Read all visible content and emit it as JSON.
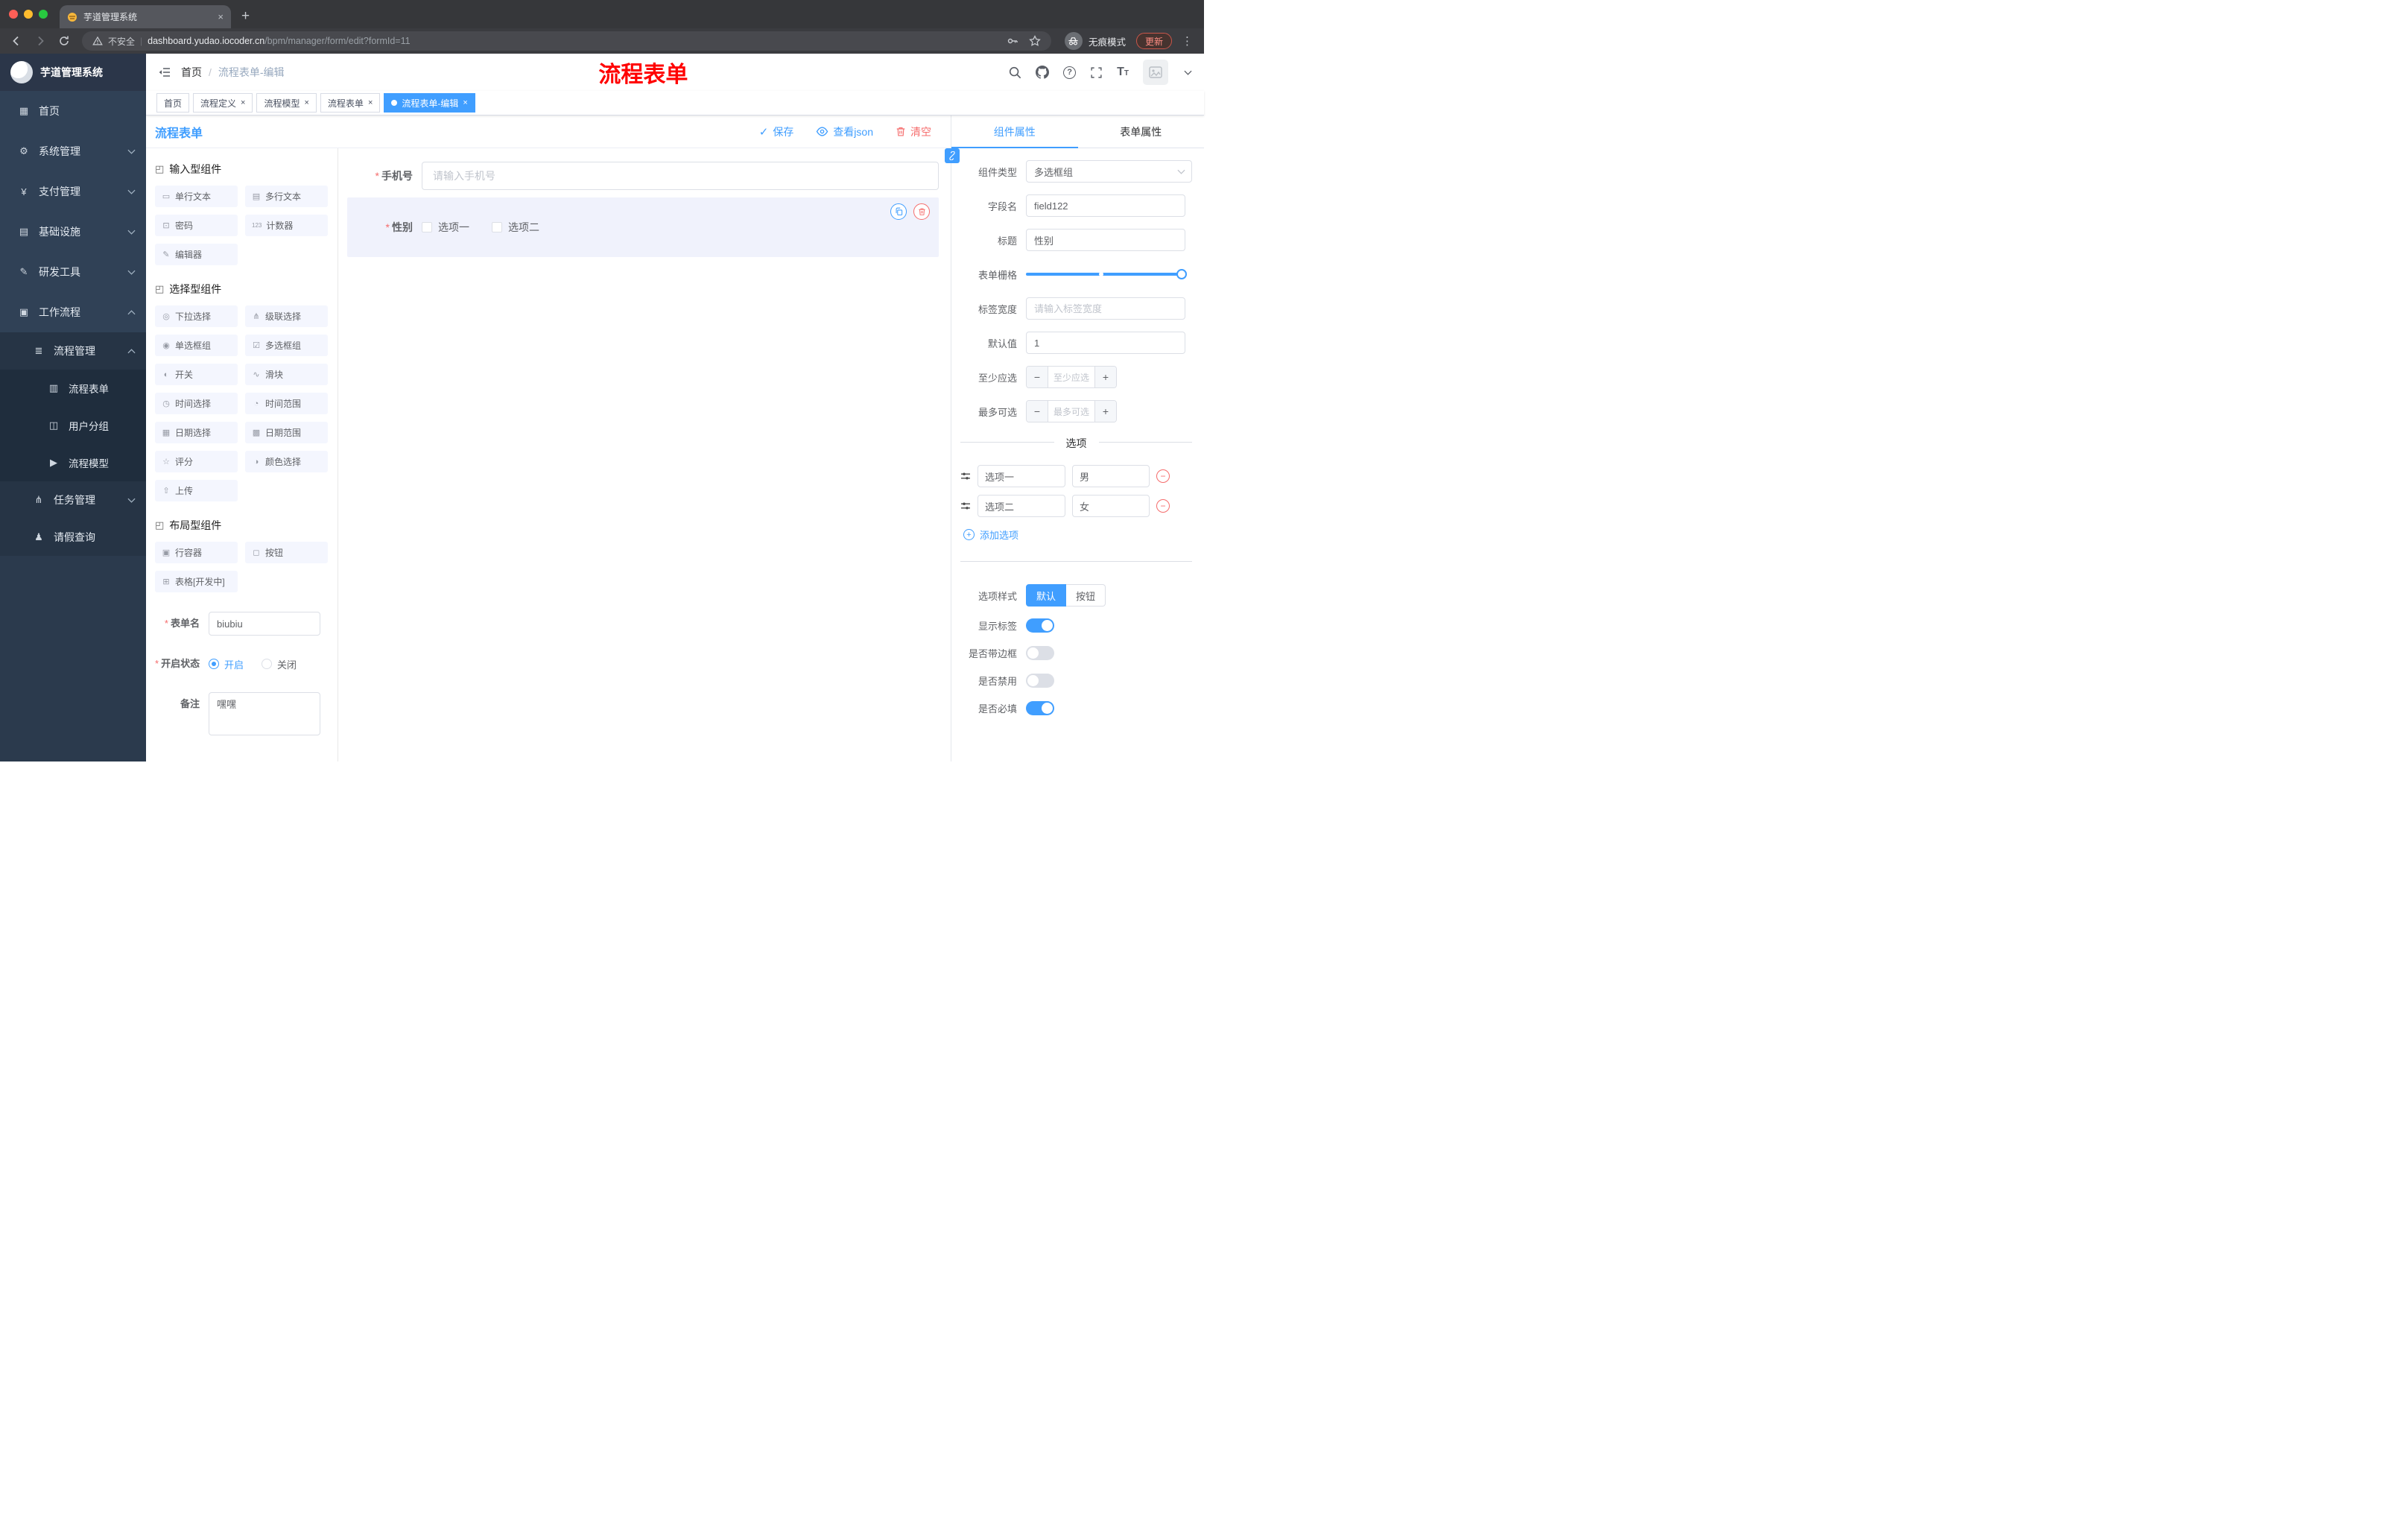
{
  "ui": {
    "close": "×",
    "plus": "+",
    "minus": "−",
    "dots": "⋮",
    "asterisk": "*",
    "pipe": "|",
    "qmark": "?",
    "t": "T",
    "check": "✓"
  },
  "chrome": {
    "tab_title": "芋道管理系统",
    "security_label": "不安全",
    "url_host": "dashboard.yudao.iocoder.cn",
    "url_path": "/bpm/manager/form/edit?formId=11",
    "incognito_label": "无痕模式",
    "update_label": "更新"
  },
  "sidebar": {
    "app_title": "芋道管理系统",
    "items": [
      {
        "label": "首页",
        "icon": "▦"
      },
      {
        "label": "系统管理",
        "icon": "⚙"
      },
      {
        "label": "支付管理",
        "icon": "¥"
      },
      {
        "label": "基础设施",
        "icon": "▤"
      },
      {
        "label": "研发工具",
        "icon": "✎"
      },
      {
        "label": "工作流程",
        "icon": "▣"
      },
      {
        "label": "流程管理",
        "icon": "≣"
      },
      {
        "label": "流程表单",
        "icon": "▥"
      },
      {
        "label": "用户分组",
        "icon": "◫"
      },
      {
        "label": "流程模型",
        "icon": "▶"
      },
      {
        "label": "任务管理",
        "icon": "⋔"
      },
      {
        "label": "请假查询",
        "icon": "♟"
      }
    ]
  },
  "header": {
    "breadcrumb_home": "首页",
    "breadcrumb_sep": "/",
    "breadcrumb_current": "流程表单-编辑",
    "annotation": "流程表单"
  },
  "tags": [
    {
      "label": "首页",
      "closable": false,
      "active": false
    },
    {
      "label": "流程定义",
      "closable": true,
      "active": false
    },
    {
      "label": "流程模型",
      "closable": true,
      "active": false
    },
    {
      "label": "流程表单",
      "closable": true,
      "active": false
    },
    {
      "label": "流程表单-编辑",
      "closable": true,
      "active": true
    }
  ],
  "designer": {
    "title": "流程表单",
    "save_label": "保存",
    "view_json_label": "查看json",
    "clear_label": "清空",
    "group_input": {
      "title": "输入型组件",
      "icon": "◰"
    },
    "group_select": {
      "title": "选择型组件",
      "icon": "◰"
    },
    "group_layout": {
      "title": "布局型组件",
      "icon": "◰"
    },
    "input_items": [
      {
        "label": "单行文本",
        "icon": "▭"
      },
      {
        "label": "多行文本",
        "icon": "▤"
      },
      {
        "label": "密码",
        "icon": "⊡"
      },
      {
        "label": "计数器",
        "icon": "123"
      },
      {
        "label": "编辑器",
        "icon": "✎"
      }
    ],
    "select_items": [
      {
        "label": "下拉选择",
        "icon": "◎"
      },
      {
        "label": "级联选择",
        "icon": "⋔"
      },
      {
        "label": "单选框组",
        "icon": "◉"
      },
      {
        "label": "多选框组",
        "icon": "☑"
      },
      {
        "label": "开关",
        "icon": "◐"
      },
      {
        "label": "滑块",
        "icon": "∿"
      },
      {
        "label": "时间选择",
        "icon": "◷"
      },
      {
        "label": "时间范围",
        "icon": "◔"
      },
      {
        "label": "日期选择",
        "icon": "▦"
      },
      {
        "label": "日期范围",
        "icon": "▩"
      },
      {
        "label": "评分",
        "icon": "☆"
      },
      {
        "label": "颜色选择",
        "icon": "◑"
      },
      {
        "label": "上传",
        "icon": "⇧"
      }
    ],
    "layout_items": [
      {
        "label": "行容器",
        "icon": "▣"
      },
      {
        "label": "按钮",
        "icon": "◻"
      },
      {
        "label": "表格[开发中]",
        "icon": "⊞"
      }
    ],
    "meta": {
      "form_name_label": "表单名",
      "form_name_value": "biubiu",
      "status_label": "开启状态",
      "status_on": "开启",
      "status_off": "关闭",
      "remark_label": "备注",
      "remark_value": "嘿嘿"
    },
    "canvas": {
      "phone_label": "手机号",
      "phone_placeholder": "请输入手机号",
      "gender_label": "性别",
      "option1": "选项一",
      "option2": "选项二"
    }
  },
  "panel": {
    "tab_component": "组件属性",
    "tab_form": "表单属性",
    "component_type_label": "组件类型",
    "component_type_value": "多选框组",
    "field_name_label": "字段名",
    "field_name_value": "field122",
    "title_label": "标题",
    "title_value": "性别",
    "grid_label": "表单栅格",
    "label_width_label": "标签宽度",
    "label_width_placeholder": "请输入标签宽度",
    "default_label": "默认值",
    "default_value": "1",
    "min_label": "至少应选",
    "min_placeholder": "至少应选",
    "max_label": "最多可选",
    "max_placeholder": "最多可选",
    "options_title": "选项",
    "options": [
      {
        "label": "选项一",
        "value": "男"
      },
      {
        "label": "选项二",
        "value": "女"
      }
    ],
    "add_option_label": "添加选项",
    "style_label": "选项样式",
    "style_default": "默认",
    "style_button": "按钮",
    "toggle_show_label": "显示标签",
    "toggle_border_label": "是否带边框",
    "toggle_disabled_label": "是否禁用",
    "toggle_required_label": "是否必填",
    "toggles": {
      "show_label": true,
      "border": false,
      "disabled": false,
      "required": true
    }
  },
  "colors": {
    "accent": "#409eff",
    "danger": "#f56c6c",
    "annotation": "#ff0000",
    "sidebar": "#304156"
  }
}
